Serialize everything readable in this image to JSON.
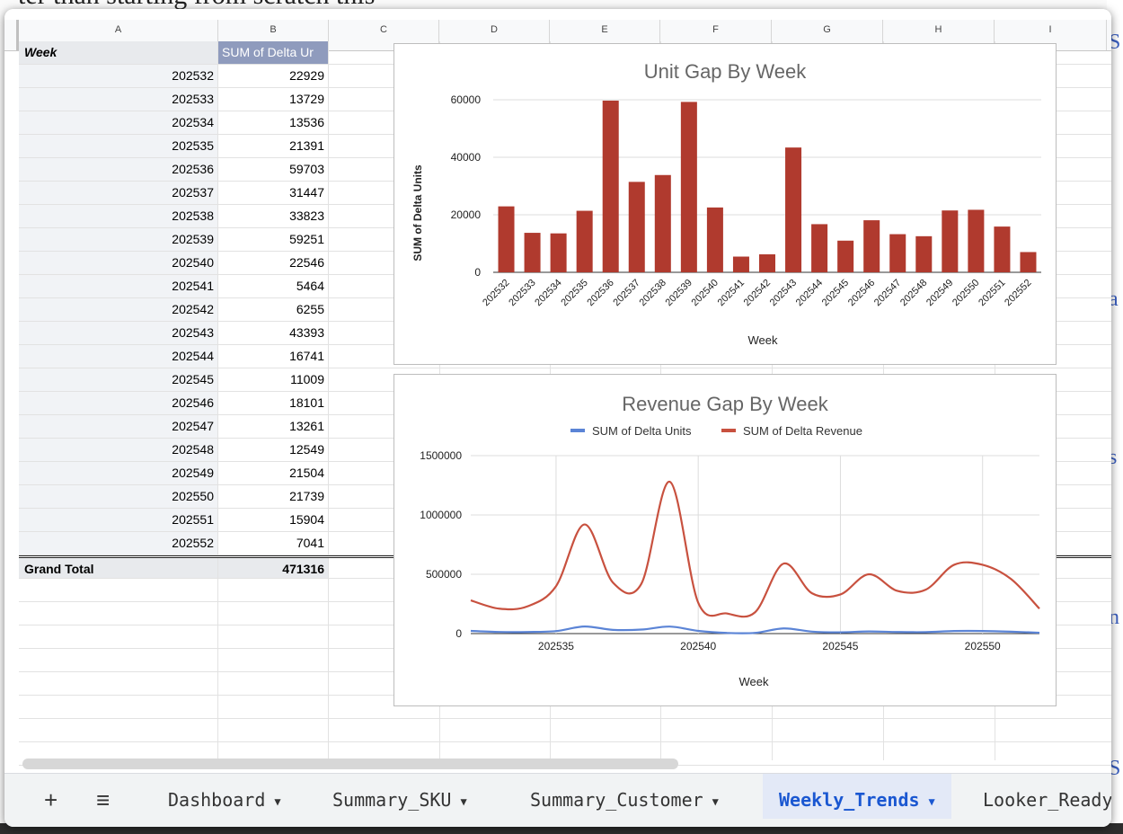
{
  "background": {
    "text": "ter than starting from scratch this"
  },
  "columns": [
    "A",
    "B",
    "C",
    "D",
    "E",
    "F",
    "G",
    "H",
    "I"
  ],
  "pivot": {
    "header_week": "Week",
    "header_value": "SUM of Delta Ur",
    "rows": [
      {
        "week": "202532",
        "value": "22929"
      },
      {
        "week": "202533",
        "value": "13729"
      },
      {
        "week": "202534",
        "value": "13536"
      },
      {
        "week": "202535",
        "value": "21391"
      },
      {
        "week": "202536",
        "value": "59703"
      },
      {
        "week": "202537",
        "value": "31447"
      },
      {
        "week": "202538",
        "value": "33823"
      },
      {
        "week": "202539",
        "value": "59251"
      },
      {
        "week": "202540",
        "value": "22546"
      },
      {
        "week": "202541",
        "value": "5464"
      },
      {
        "week": "202542",
        "value": "6255"
      },
      {
        "week": "202543",
        "value": "43393"
      },
      {
        "week": "202544",
        "value": "16741"
      },
      {
        "week": "202545",
        "value": "11009"
      },
      {
        "week": "202546",
        "value": "18101"
      },
      {
        "week": "202547",
        "value": "13261"
      },
      {
        "week": "202548",
        "value": "12549"
      },
      {
        "week": "202549",
        "value": "21504"
      },
      {
        "week": "202550",
        "value": "21739"
      },
      {
        "week": "202551",
        "value": "15904"
      },
      {
        "week": "202552",
        "value": "7041"
      }
    ],
    "total_label": "Grand Total",
    "total_value": "471316"
  },
  "tabs": {
    "add": "+",
    "menu": "≡",
    "items": [
      {
        "label": "Dashboard"
      },
      {
        "label": "Summary_SKU"
      },
      {
        "label": "Summary_Customer"
      },
      {
        "label": "Weekly_Trends"
      },
      {
        "label": "Looker_Ready"
      }
    ]
  },
  "colors": {
    "bar": "#b03a2e",
    "units_line": "#5b84d6",
    "revenue_line": "#c8513f"
  },
  "chart_data": [
    {
      "type": "bar",
      "title": "Unit Gap By Week",
      "xlabel": "Week",
      "ylabel": "SUM of Delta Units",
      "ylim": [
        0,
        60000
      ],
      "yticks": [
        "0",
        "20000",
        "40000",
        "60000"
      ],
      "categories": [
        "202532",
        "202533",
        "202534",
        "202535",
        "202536",
        "202537",
        "202538",
        "202539",
        "202540",
        "202541",
        "202542",
        "202543",
        "202544",
        "202545",
        "202546",
        "202547",
        "202548",
        "202549",
        "202550",
        "202551",
        "202552"
      ],
      "values": [
        22929,
        13729,
        13536,
        21391,
        59703,
        31447,
        33823,
        59251,
        22546,
        5464,
        6255,
        43393,
        16741,
        11009,
        18101,
        13261,
        12549,
        21504,
        21739,
        15904,
        7041
      ],
      "grid": true
    },
    {
      "type": "line",
      "title": "Revenue Gap By Week",
      "xlabel": "Week",
      "ylim": [
        0,
        1500000
      ],
      "yticks": [
        "0",
        "500000",
        "1000000",
        "1500000"
      ],
      "xticks": [
        "202535",
        "202540",
        "202545",
        "202550"
      ],
      "legend": "top",
      "x": [
        202532,
        202533,
        202534,
        202535,
        202536,
        202537,
        202538,
        202539,
        202540,
        202541,
        202542,
        202543,
        202544,
        202545,
        202546,
        202547,
        202548,
        202549,
        202550,
        202551,
        202552
      ],
      "series": [
        {
          "name": "SUM of Delta Units",
          "values": [
            22929,
            13729,
            13536,
            21391,
            59703,
            31447,
            33823,
            59251,
            22546,
            5464,
            6255,
            43393,
            16741,
            11009,
            18101,
            13261,
            12549,
            21504,
            21739,
            15904,
            7041
          ]
        },
        {
          "name": "SUM of Delta Revenue",
          "values": [
            280000,
            210000,
            230000,
            400000,
            920000,
            430000,
            420000,
            1280000,
            260000,
            170000,
            180000,
            590000,
            340000,
            330000,
            500000,
            360000,
            370000,
            580000,
            580000,
            460000,
            210000
          ]
        }
      ],
      "grid": true
    }
  ]
}
